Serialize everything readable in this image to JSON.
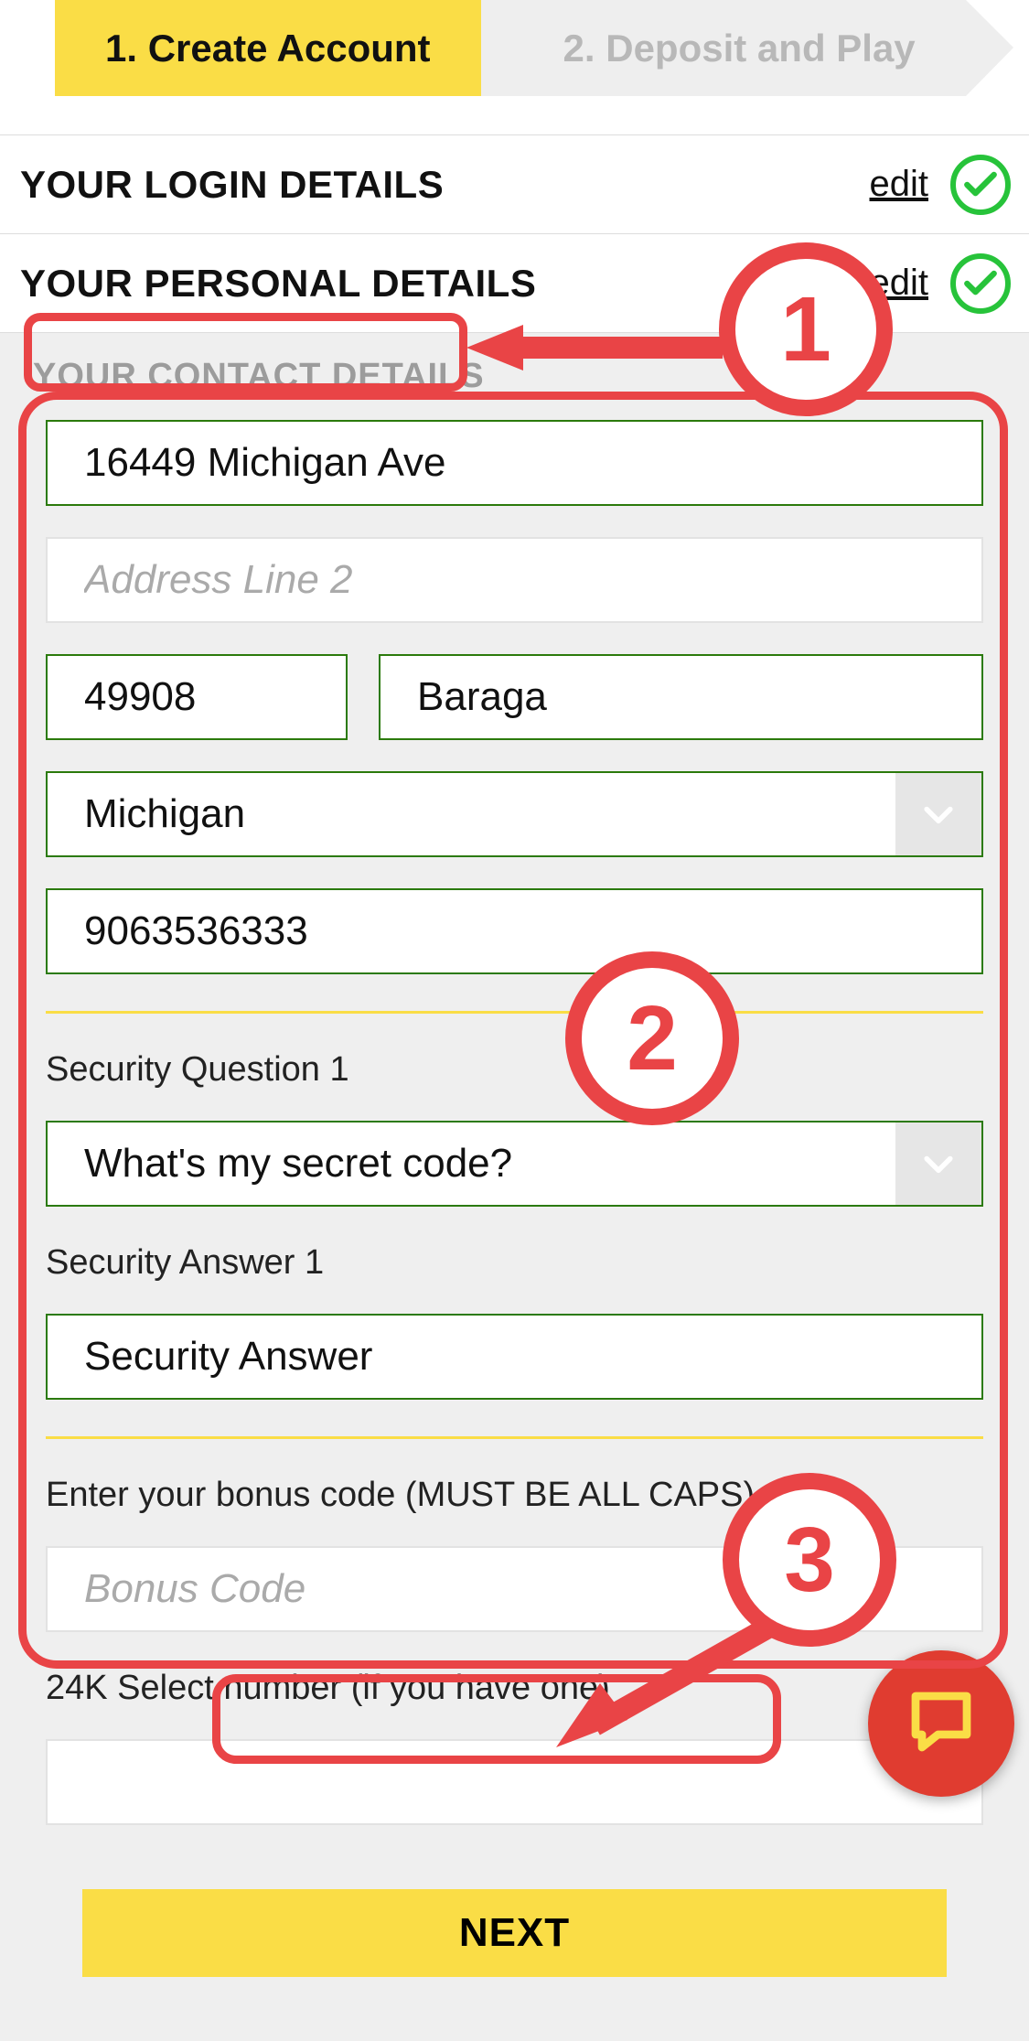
{
  "stepper": {
    "active": "1. Create Account",
    "inactive": "2. Deposit and Play"
  },
  "sections": {
    "login": {
      "title": "YOUR LOGIN DETAILS",
      "edit": "edit"
    },
    "personal": {
      "title": "YOUR PERSONAL DETAILS",
      "edit": "edit"
    },
    "contact": {
      "title": "YOUR CONTACT DETAILS"
    }
  },
  "form": {
    "addr1": "16449 Michigan Ave",
    "addr2_placeholder": "Address Line 2",
    "zip": "49908",
    "city": "Baraga",
    "state": "Michigan",
    "phone": "9063536333",
    "secq_label": "Security Question 1",
    "secq": "What's my secret code?",
    "seca_label": "Security Answer 1",
    "seca": "Security Answer",
    "bonus_label": "Enter your bonus code (MUST BE ALL CAPS).",
    "bonus_placeholder": "Bonus Code",
    "select24_label": "24K Select number (if you have one)"
  },
  "next_btn": "NEXT",
  "annotations": {
    "1": "1",
    "2": "2",
    "3": "3"
  }
}
